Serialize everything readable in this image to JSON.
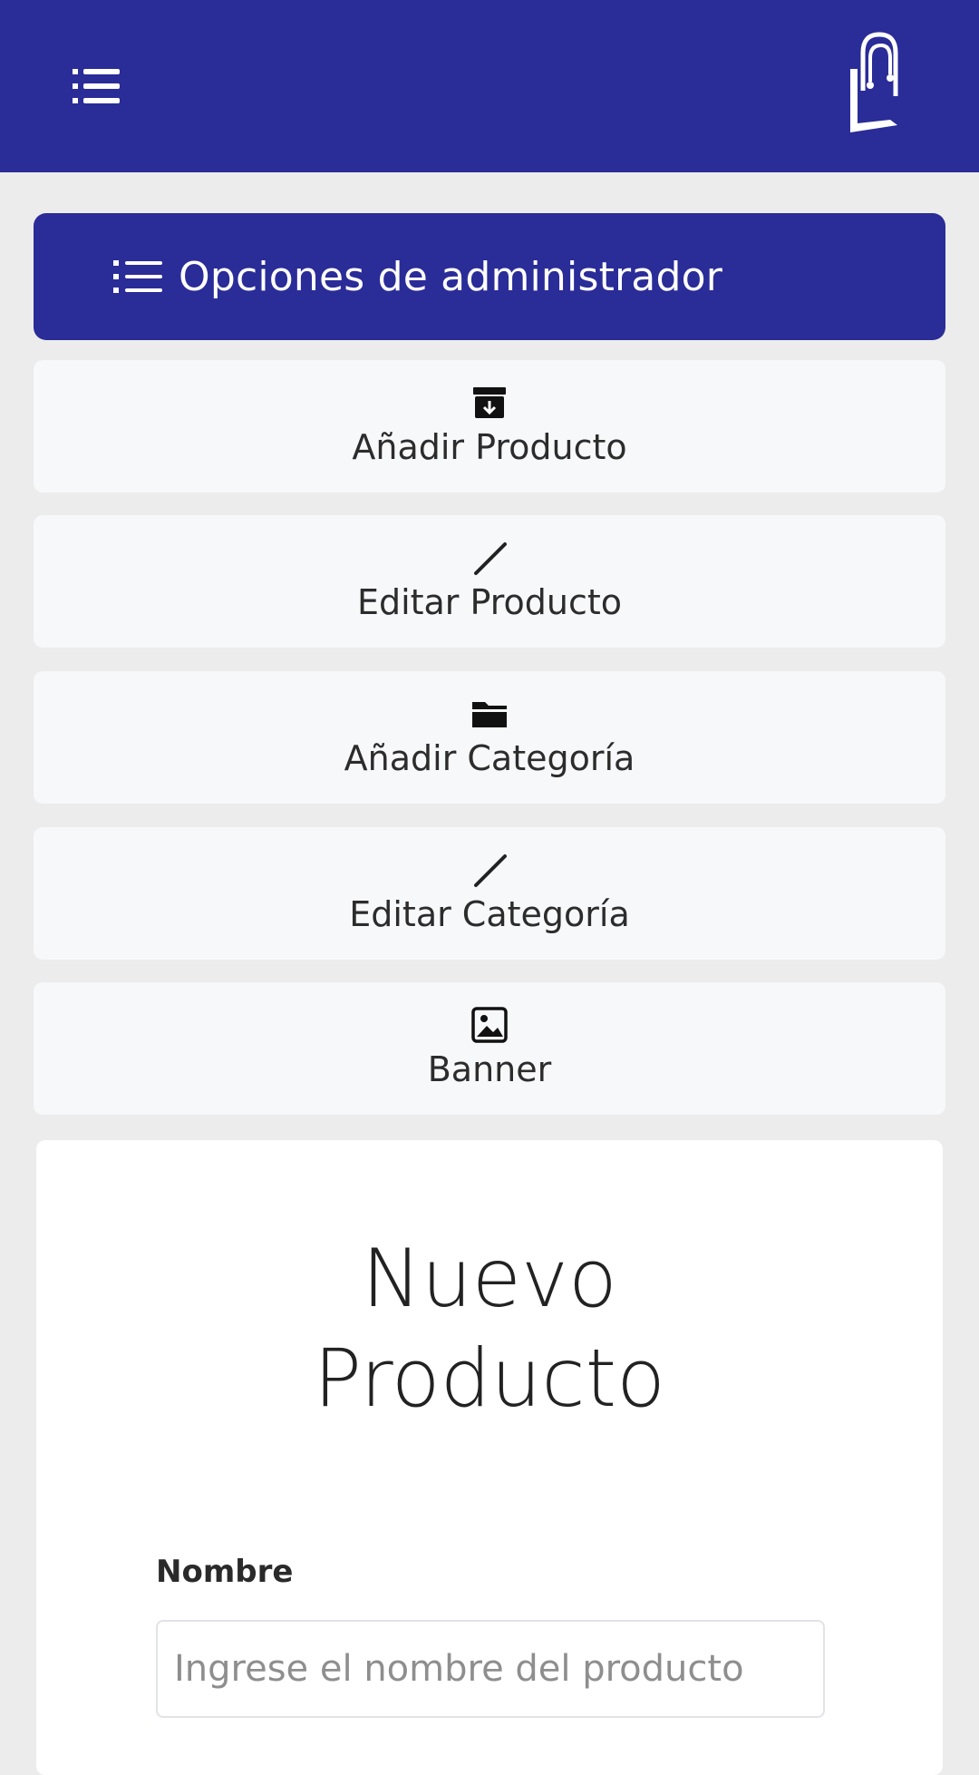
{
  "topbar": {
    "menu_icon": "list-icon",
    "logo_icon": "shopping-bag-logo",
    "brand_color": "#2a2c98"
  },
  "admin_panel": {
    "title": "Opciones de administrador",
    "icon": "list-icon",
    "options": [
      {
        "label": "Añadir Producto",
        "icon": "archive-icon"
      },
      {
        "label": "Editar Producto",
        "icon": "pencil-icon"
      },
      {
        "label": "Añadir Categoría",
        "icon": "folder-icon"
      },
      {
        "label": "Editar Categoría",
        "icon": "pencil-icon"
      },
      {
        "label": "Banner",
        "icon": "image-icon"
      }
    ]
  },
  "form": {
    "title_line1": "Nuevo",
    "title_line2": "Producto",
    "fields": [
      {
        "label": "Nombre",
        "value": "",
        "placeholder": "Ingrese el nombre del producto"
      }
    ]
  }
}
